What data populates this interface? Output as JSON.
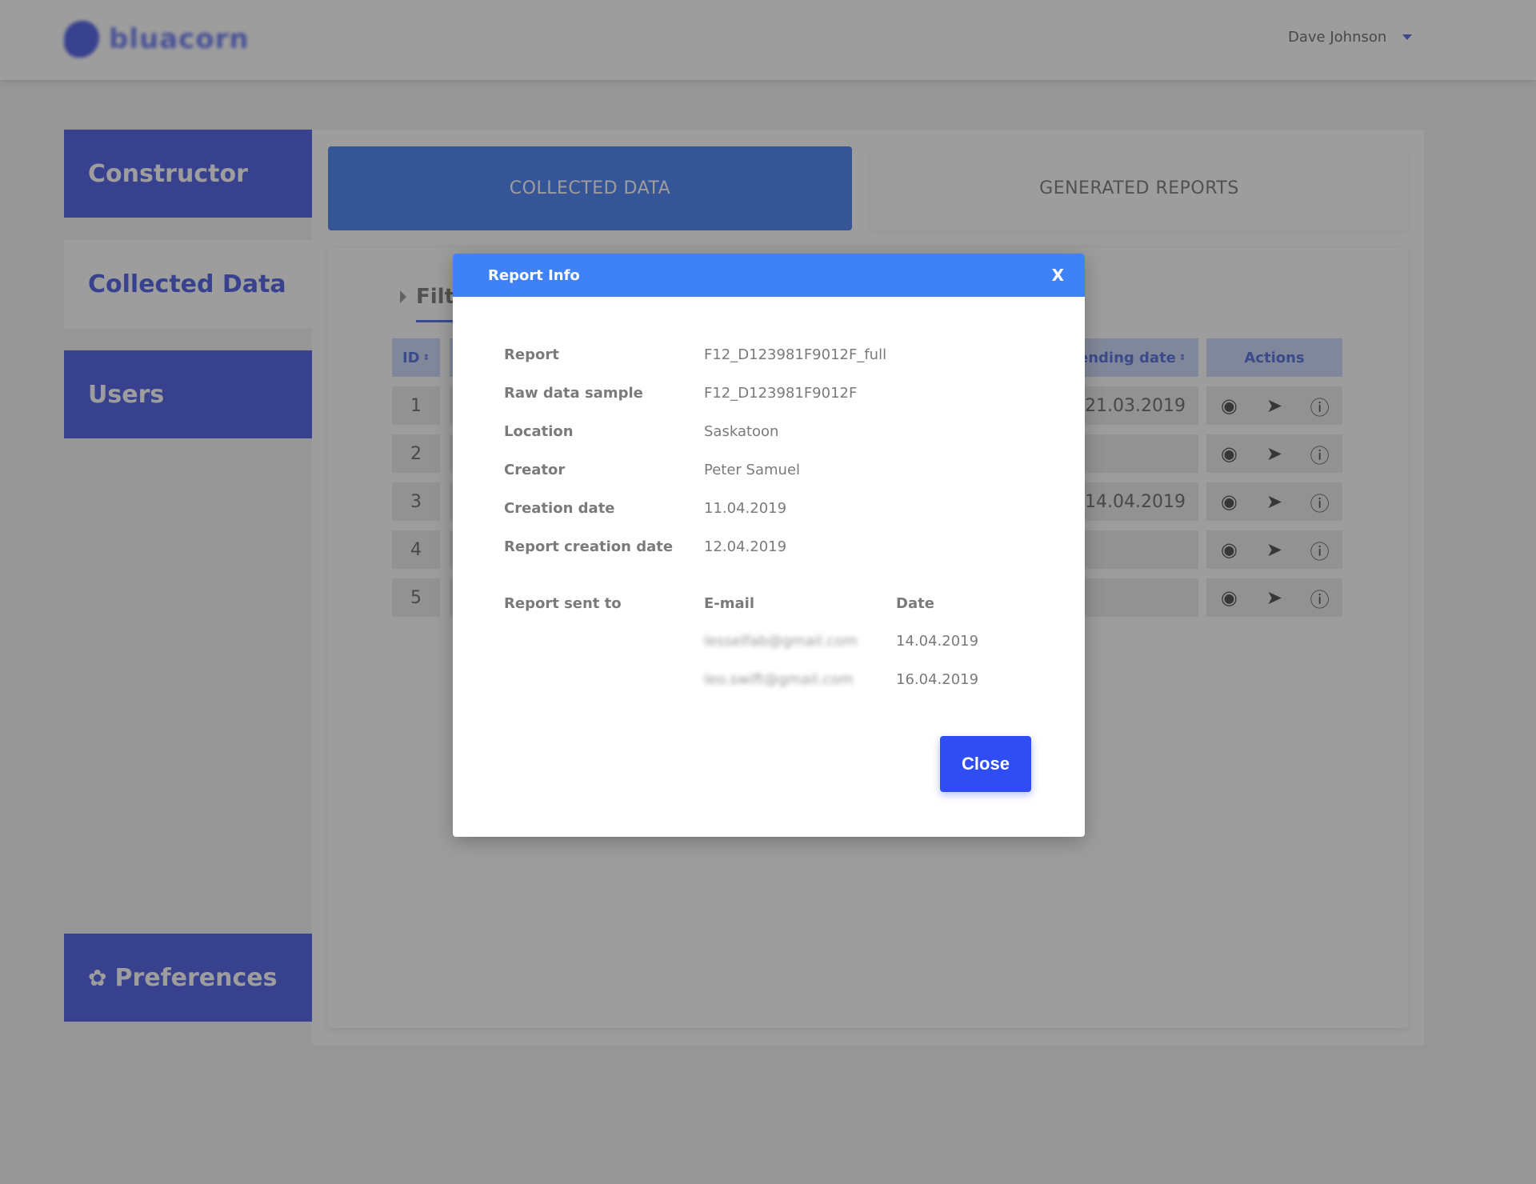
{
  "header": {
    "logo_text": "bluacorn",
    "user_name": "Dave Johnson"
  },
  "sidebar": {
    "items": [
      {
        "label": "Constructor"
      },
      {
        "label": "Collected Data"
      },
      {
        "label": "Users"
      }
    ],
    "preferences_label": "Preferences"
  },
  "tabs": {
    "collected": "COLLECTED DATA",
    "generated": "GENERATED REPORTS"
  },
  "filter": {
    "label": "Filte"
  },
  "table": {
    "headers": {
      "id": "ID",
      "sending_date": "ending date",
      "actions": "Actions"
    },
    "rows": [
      {
        "id": "1",
        "sending_date": "21.03.2019"
      },
      {
        "id": "2",
        "sending_date": ""
      },
      {
        "id": "3",
        "sending_date": "14.04.2019"
      },
      {
        "id": "4",
        "sending_date": ""
      },
      {
        "id": "5",
        "sending_date": ""
      }
    ]
  },
  "modal": {
    "title": "Report Info",
    "close_x": "X",
    "fields": [
      {
        "label": "Report",
        "value": "F12_D123981F9012F_full"
      },
      {
        "label": "Raw data sample",
        "value": "F12_D123981F9012F"
      },
      {
        "label": "Location",
        "value": "Saskatoon"
      },
      {
        "label": "Creator",
        "value": "Peter Samuel"
      },
      {
        "label": "Creation date",
        "value": "11.04.2019"
      },
      {
        "label": "Report creation date",
        "value": "12.04.2019"
      }
    ],
    "sent_to_label": "Report sent to",
    "email_header": "E-mail",
    "date_header": "Date",
    "recipients": [
      {
        "email": "lesselfab@gmail.com",
        "date": "14.04.2019"
      },
      {
        "email": "leo.swift@gmail.com",
        "date": "16.04.2019"
      }
    ],
    "close_button": "Close"
  },
  "colors": {
    "brand_blue": "#3347e0",
    "tab_blue": "#2f6ef2",
    "modal_header": "#3f82f8",
    "close_button": "#2f4df2"
  }
}
